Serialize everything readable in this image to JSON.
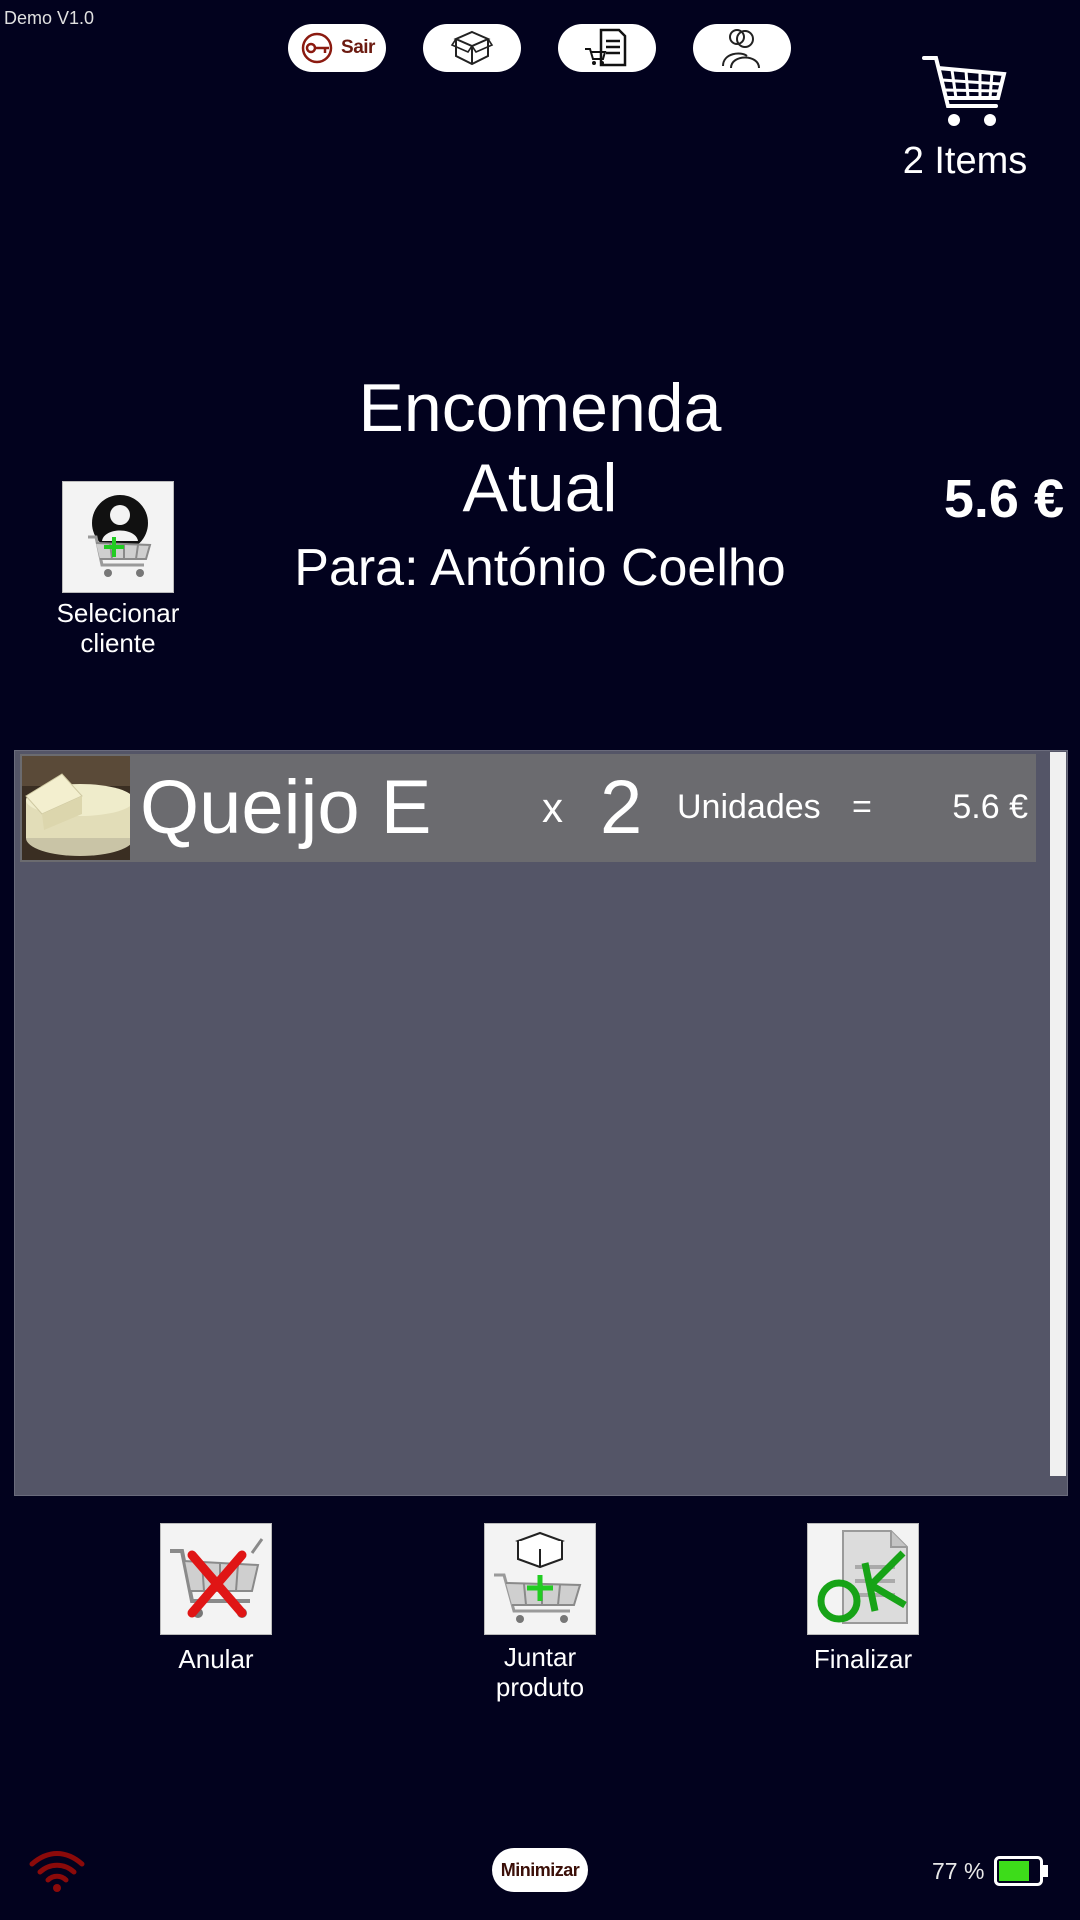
{
  "app": {
    "version_label": "Demo V1.0"
  },
  "topbar": {
    "exit_label": "Sair",
    "icons": [
      "key-icon",
      "box-icon",
      "cart-document-icon",
      "users-icon"
    ]
  },
  "cart": {
    "count_label": "2 Items"
  },
  "order": {
    "title_line1": "Encomenda",
    "title_line2": "Atual",
    "for_label": "Para: António Coelho",
    "total": "5.6 €"
  },
  "customer_button": {
    "label_line1": "Selecionar",
    "label_line2": "cliente"
  },
  "items": [
    {
      "name": "Queijo E",
      "times": "x",
      "quantity": "2",
      "unit": "Unidades",
      "equals": "=",
      "price": "5.6 €"
    }
  ],
  "actions": {
    "cancel": "Anular",
    "add_line1": "Juntar",
    "add_line2": "produto",
    "finish": "Finalizar"
  },
  "statusbar": {
    "minimize_label": "Minimizar",
    "battery_label": "77 %",
    "battery_level": 0.77,
    "wifi_color": "#8b0a0a",
    "battery_color": "#3ddc1a"
  }
}
